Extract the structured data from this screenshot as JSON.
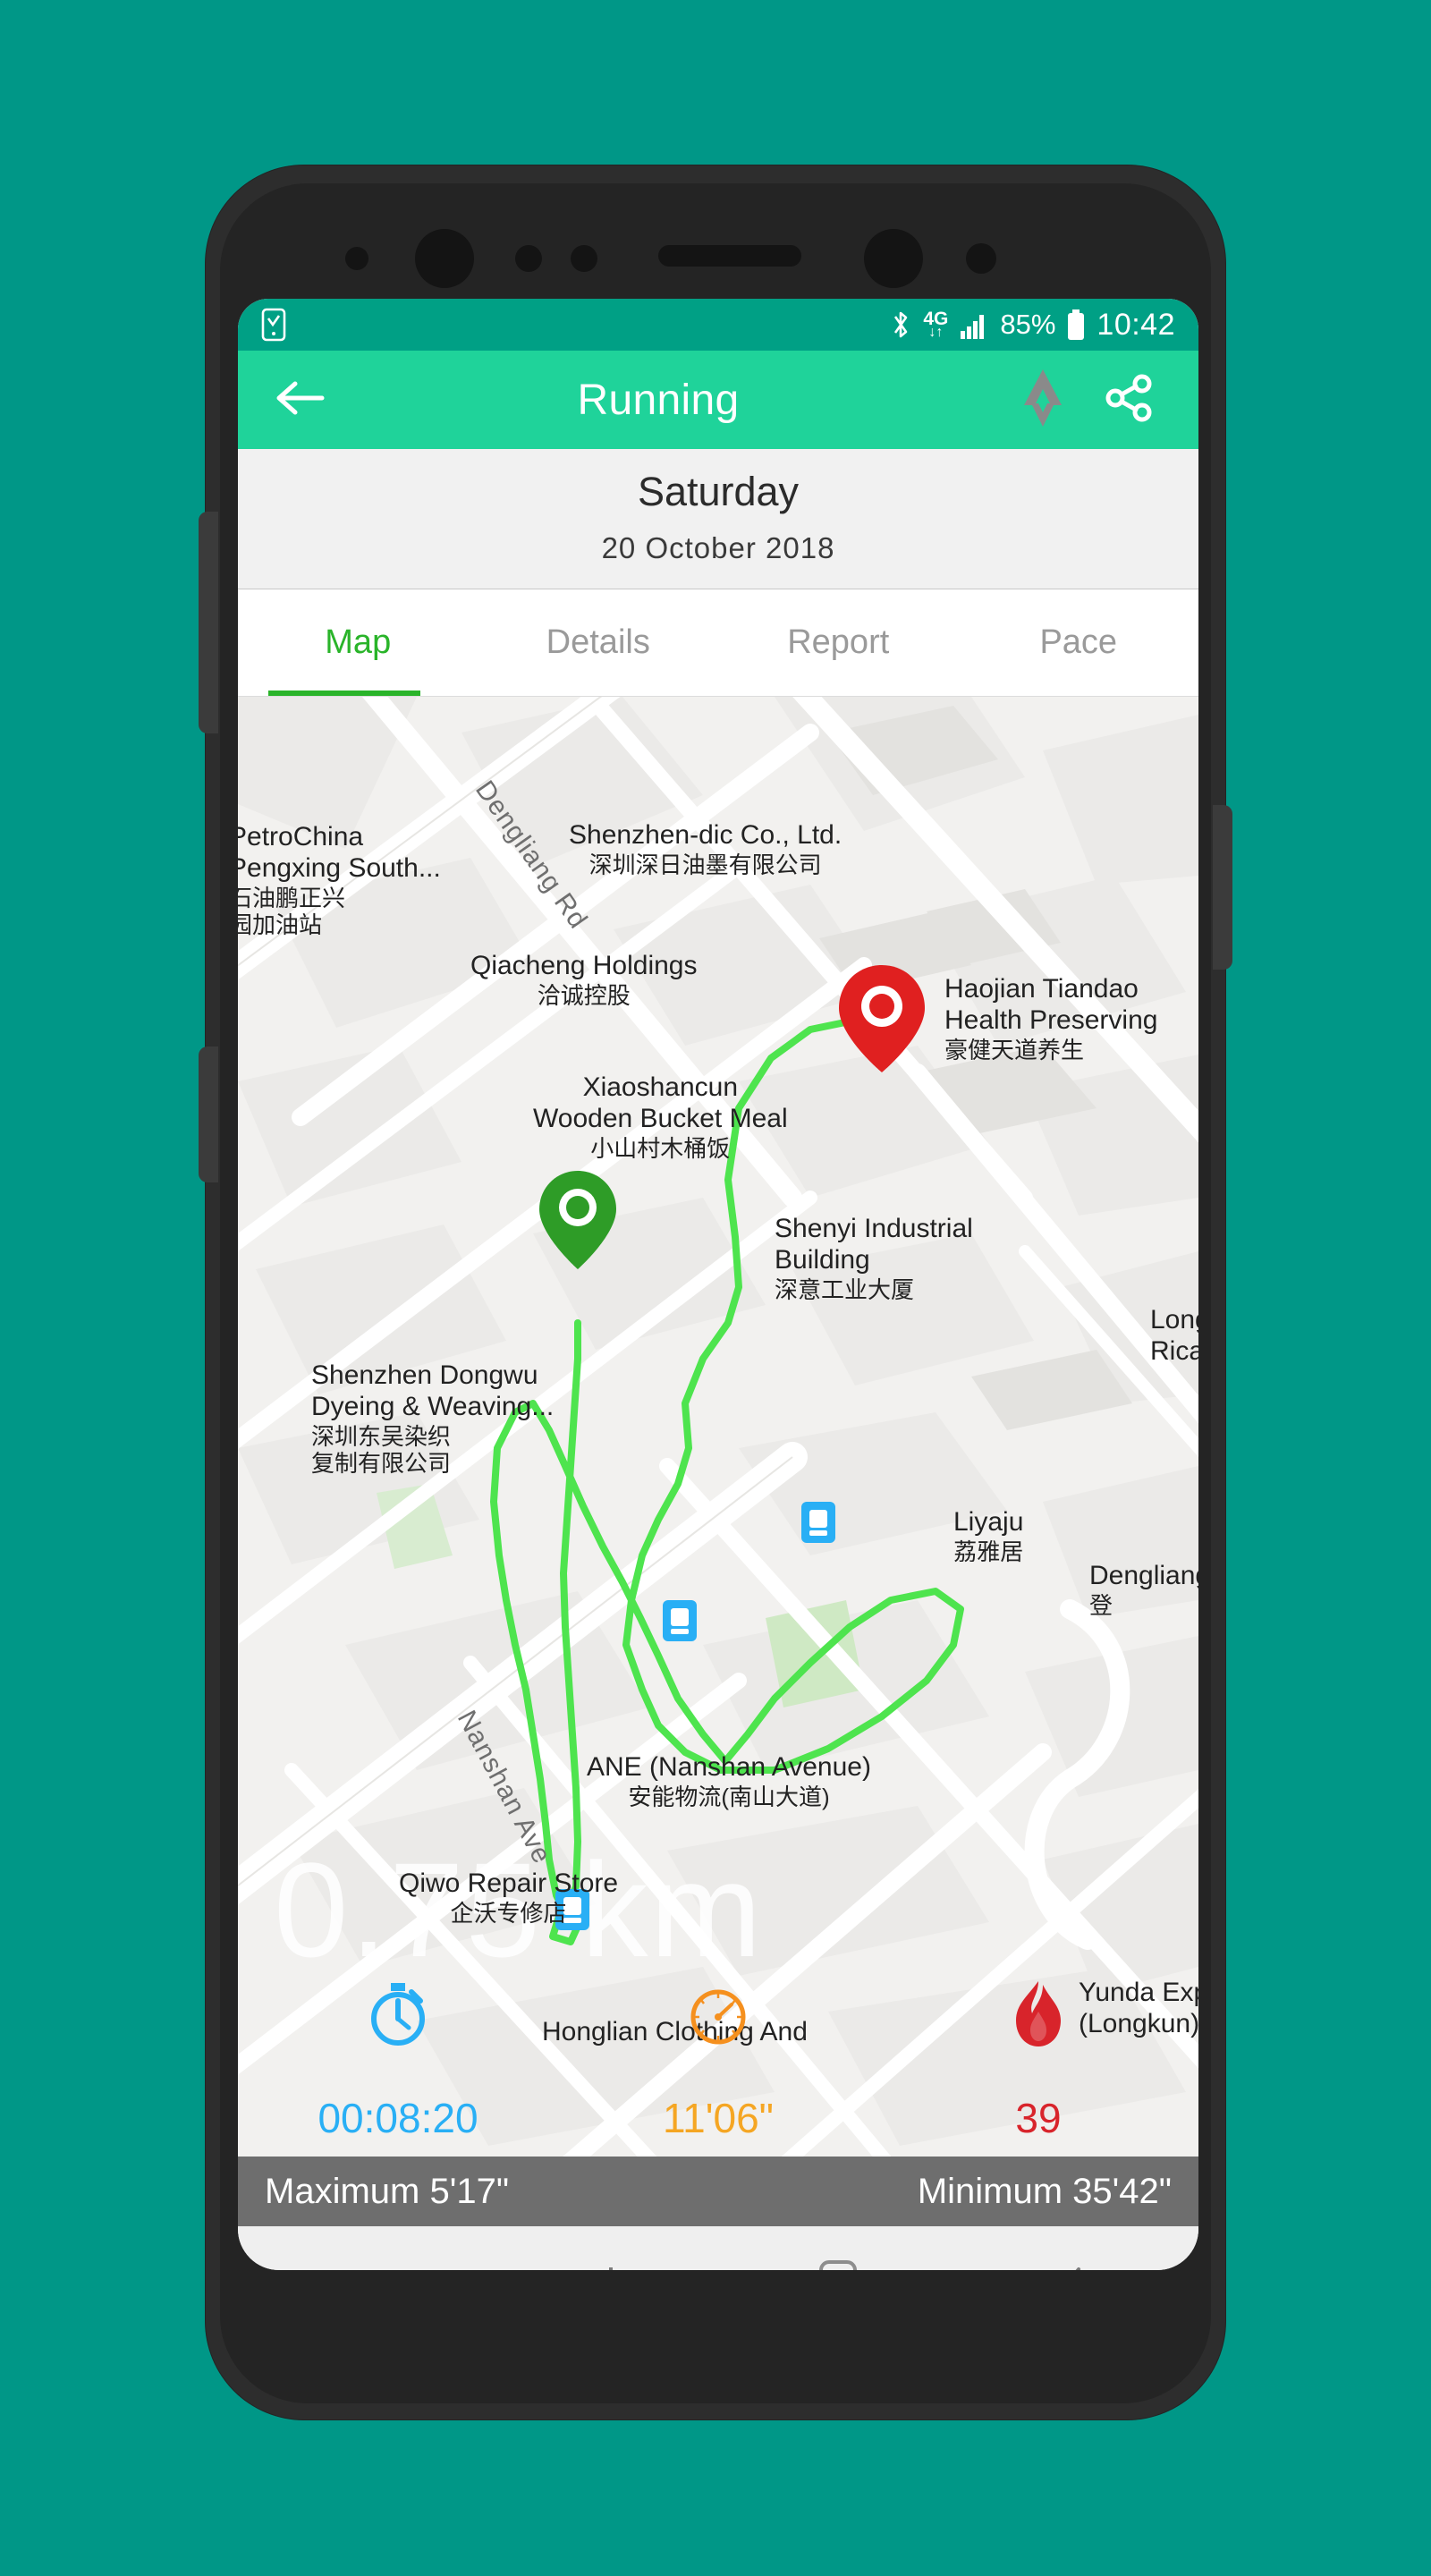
{
  "status_bar": {
    "left_icon": "sim-check-icon",
    "bluetooth_icon": "bluetooth-icon",
    "network_label": "4G",
    "network_arrows": "↓↑",
    "signal_icon": "signal-bars-icon",
    "battery_percent": "85%",
    "battery_icon": "battery-icon",
    "clock": "10:42"
  },
  "app_bar": {
    "back_icon": "arrow-left-icon",
    "title": "Running",
    "activity_icon": "activity-chevrons-icon",
    "share_icon": "share-nodes-icon"
  },
  "date_header": {
    "weekday": "Saturday",
    "date": "20  October  2018"
  },
  "tabs": [
    {
      "label": "Map",
      "active": true
    },
    {
      "label": "Details",
      "active": false
    },
    {
      "label": "Report",
      "active": false
    },
    {
      "label": "Pace",
      "active": false
    }
  ],
  "map": {
    "distance_watermark": "0.75 km",
    "start_marker": "start-pin-green",
    "end_marker": "end-pin-red",
    "route_color": "#4ee44e",
    "roads": [
      {
        "name": "Dengliang Rd"
      },
      {
        "name": "Nanshan Ave"
      }
    ],
    "places": [
      {
        "en": "PetroChina",
        "en2": "Pengxing South...",
        "zh": "石油鹏正兴",
        "zh2": "园加油站"
      },
      {
        "en": "Shenzhen-dic Co., Ltd.",
        "zh": "深圳深日油墨有限公司"
      },
      {
        "en": "Qiacheng Holdings",
        "zh": "洽诚控股"
      },
      {
        "en": "Xiaoshancun",
        "en2": "Wooden Bucket Meal",
        "zh": "小山村木桶饭"
      },
      {
        "en": "Haojian Tiandao",
        "en2": "Health Preserving",
        "zh": "豪健天道养生"
      },
      {
        "en": "Shenzhen Dongwu",
        "en2": "Dyeing & Weaving...",
        "zh": "深圳东吴染织",
        "zh2": "复制有限公司"
      },
      {
        "en": "Shenyi Industrial",
        "en2": "Building",
        "zh": "深意工业大厦"
      },
      {
        "en": "Longcheng",
        "en2": "Ricai"
      },
      {
        "en": "Liyaju",
        "zh": "荔雅居"
      },
      {
        "en": "Dengliang",
        "zh": "登"
      },
      {
        "en": "ANE (Nanshan Avenue)",
        "zh": "安能物流(南山大道)"
      },
      {
        "en": "Qiwo Repair Store",
        "zh": "企沃专修店"
      },
      {
        "en": "Honglian Clothing And",
        "zh": ""
      },
      {
        "en": "Yunda Express",
        "en2": "(Longkun)"
      }
    ]
  },
  "stats": [
    {
      "id": "duration",
      "icon": "stopwatch-icon",
      "value": "00:08:20",
      "color": "#29aff5"
    },
    {
      "id": "pace",
      "icon": "speedometer-icon",
      "value": "11'06\"",
      "color": "#f5a623"
    },
    {
      "id": "calories",
      "icon": "flame-icon",
      "value": "39",
      "color": "#d8242b"
    }
  ],
  "pace_bar": {
    "maximum": "Maximum 5'17\"",
    "minimum": "Minimum 35'42\""
  },
  "nav_bar": {
    "dot_icon": "nav-dot-icon",
    "recents_icon": "recents-icon",
    "home_icon": "home-square-icon",
    "back_icon": "nav-back-arrow-icon"
  },
  "colors": {
    "page_background": "#009787",
    "status_bar": "#00a085",
    "app_bar": "#1fd39a",
    "accent_green": "#2ab42a",
    "route": "#4ee44e",
    "pace_bar": "#6e6e6e"
  }
}
